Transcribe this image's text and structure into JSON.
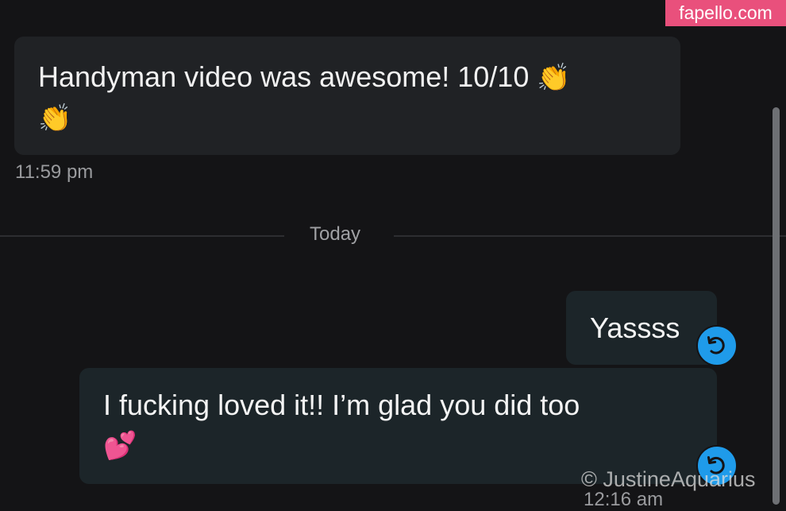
{
  "watermark_top": "fapello.com",
  "incoming": {
    "text": "Handyman video was awesome! 10/10 ",
    "emoji_a": "👏",
    "emoji_b": "👏",
    "time": "11:59 pm"
  },
  "divider": {
    "label": "Today"
  },
  "outgoing": [
    {
      "text": "Yassss"
    },
    {
      "text": "I fucking loved it!! I’m glad you did too",
      "emoji": "💕"
    }
  ],
  "outgoing_time": "12:16 am",
  "watermark_bottom": "©  JustineAquarius",
  "icons": {
    "reply": "undo-icon"
  },
  "colors": {
    "accent": "#1f9bea",
    "watermark_bg": "#e9507c"
  }
}
